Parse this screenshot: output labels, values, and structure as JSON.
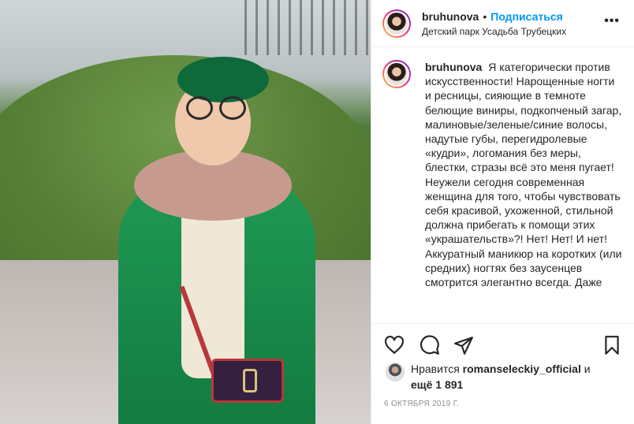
{
  "post": {
    "username": "bruhunova",
    "separator": "•",
    "follow_label": "Подписаться",
    "location": "Детский парк Усадьба Трубецких",
    "more_icon": "more-icon"
  },
  "caption": {
    "username": "bruhunova",
    "text": "Я категорически против искусственности! Нарощенные ногти и ресницы, сияющие в темноте белющие виниры, подкопченый загар, малиновые/зеленые/синие волосы, надутые губы, перегидролевые «кудри», логомания без меры, блестки, стразы всё это меня пугает! Неужели сегодня современная женщина для того, чтобы чувствовать себя красивой, ухоженной, стильной должна прибегать к помощи этих «украшательств»?! Нет! Нет! И нет! Аккуратный маникюр на коротких (или средних) ногтях без заусенцев смотрится элегантно всегда. Даже"
  },
  "actions": {
    "like_icon": "heart-icon",
    "comment_icon": "comment-icon",
    "share_icon": "share-icon",
    "save_icon": "bookmark-icon"
  },
  "likes": {
    "prefix": "Нравится",
    "user": "romanseleckiy_official",
    "connector": "и",
    "others": "ещё 1 891"
  },
  "date": "6 октября 2019 г.",
  "colors": {
    "link": "#0095f6",
    "text": "#262626",
    "muted": "#8e8e8e"
  }
}
